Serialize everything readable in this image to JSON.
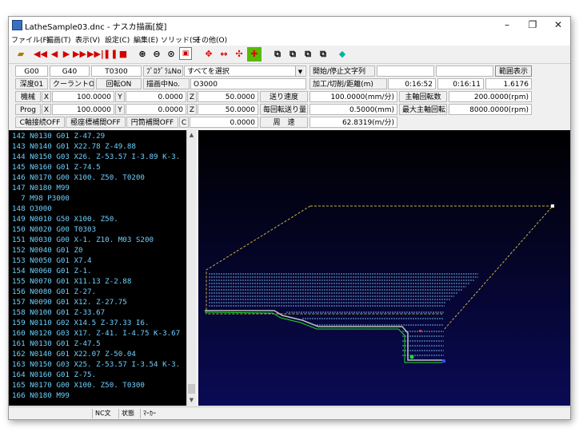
{
  "window": {
    "title": "LatheSample03.dnc - ナスカ描画[旋]",
    "minimize": "–",
    "maximize": "❐",
    "close": "✕"
  },
  "menu": [
    "ファイル(F)",
    "描画(T)",
    "表示(V)",
    "設定(C)",
    "編集(E)",
    "ソリッド(S)",
    "その他(O)"
  ],
  "toolbar": {
    "icons": [
      "open-icon",
      "rewind-icon",
      "step-back-icon",
      "play-icon",
      "fast-forward-icon",
      "skip-end-icon",
      "pause-icon",
      "stop-icon",
      "zoom-in-icon",
      "zoom-out-icon",
      "zoom-fit-icon",
      "zoom-window-icon",
      "move-icon",
      "pan-horizontal-icon",
      "pan-vertical-icon",
      "origin-icon",
      "view-3d-1-icon",
      "view-3d-2-icon",
      "view-3d-3-icon",
      "view-3d-4-icon",
      "solid-toggle-icon"
    ]
  },
  "info": {
    "row1": {
      "g1": "G00",
      "g2": "G40",
      "tool": "T0300",
      "prog_label": "ﾌﾟﾛｸﾞﾗﾑNo",
      "prog_value": "すべてを選択",
      "start_stop_label": "開始/停止文字列",
      "start_stop_value": "",
      "range_button": "範囲表示"
    },
    "row2": {
      "depth": "深度01",
      "coolant": "クーラントOFF",
      "rotation": "回転ON",
      "drawing_label": "描画中No.",
      "drawing_value": "O3000",
      "process_label": "加工/切削/距離(m)",
      "t1": "0:16:52",
      "t2": "0:16:11",
      "dist": "1.6176"
    },
    "row3": {
      "label": "機械",
      "x_label": "X",
      "x": "100.0000",
      "y_label": "Y",
      "y": "0.0000",
      "z_label": "Z",
      "z": "50.0000",
      "feed_label": "送り速度",
      "feed": "100.0000(mm/分)",
      "spindle_label": "主軸回転数",
      "spindle": "200.0000(rpm)"
    },
    "row4": {
      "label": "Prog",
      "x_label": "X",
      "x": "100.0000",
      "y_label": "Y",
      "y": "0.0000",
      "z_label": "Z",
      "z": "50.0000",
      "per_rev_label": "毎回転送り量",
      "per_rev": "0.5000(mm)",
      "max_spindle_label": "最大主軸回転",
      "max_spindle": "8000.0000(rpm)"
    },
    "row5": {
      "c_axis": "C軸接続OFF",
      "polar": "極座標補間OFF",
      "cyl": "円筒補間OFF",
      "c_label": "C",
      "c": "0.0000",
      "speed_label": "周　速",
      "speed": "62.8319(m/分)"
    }
  },
  "code_lines": [
    "142 N0130 G01 Z-47.29",
    "143 N0140 G01 X22.78 Z-49.88",
    "144 N0150 G03 X26. Z-53.57 I-3.89 K-3.",
    "145 N0160 G01 Z-74.5",
    "146 N0170 G00 X100. Z50. T0200",
    "147 N0180 M99",
    "  7 M98 P3000",
    "148 O3000",
    "149 N0010 G50 X100. Z50.",
    "150 N0020 G00 T0303",
    "151 N0030 G00 X-1. Z10. M03 S200",
    "152 N0040 G01 Z0",
    "153 N0050 G01 X7.4",
    "154 N0060 G01 Z-1.",
    "155 N0070 G01 X11.13 Z-2.88",
    "156 N0080 G01 Z-27.",
    "157 N0090 G01 X12. Z-27.75",
    "158 N0100 G01 Z-33.67",
    "159 N0110 G02 X14.5 Z-37.33 I6.",
    "160 N0120 G03 X17. Z-41. I-4.75 K-3.67",
    "161 N0130 G01 Z-47.5",
    "162 N0140 G01 X22.07 Z-50.04",
    "163 N0150 G03 X25. Z-53.57 I-3.54 K-3.",
    "164 N0160 G01 Z-75.",
    "165 N0170 G00 X100. Z50. T0300",
    "166 N0180 M99"
  ],
  "scrollbar": {
    "up": "▲",
    "down": "▼"
  },
  "status": {
    "s1": "NC文",
    "s2": "状態",
    "s3": "ﾏｰｶｰ"
  },
  "colors": {
    "code_text": "#6fd0ff",
    "viewport_bg": "#000018",
    "rapid_path": "#c8b040",
    "cut_path": "#6fa8dc",
    "profile": "#c0c0c0",
    "tool_point": "#22dd22"
  }
}
